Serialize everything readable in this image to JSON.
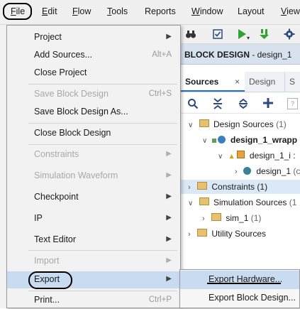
{
  "menubar": {
    "items": [
      {
        "label": "File",
        "mnemonic": "F",
        "rest": "ile"
      },
      {
        "label": "Edit",
        "mnemonic": "E",
        "rest": "dit"
      },
      {
        "label": "Flow",
        "mnemonic": "F",
        "rest": "low"
      },
      {
        "label": "Tools",
        "mnemonic": "T",
        "rest": "ools"
      },
      {
        "label": "Reports",
        "mnemonic": "",
        "rest": "Reports"
      },
      {
        "label": "Window",
        "mnemonic": "W",
        "rest": "indow"
      },
      {
        "label": "Layout",
        "mnemonic": "",
        "rest": "Layout"
      },
      {
        "label": "View",
        "mnemonic": "V",
        "rest": "iew"
      }
    ]
  },
  "file_menu": {
    "items": [
      {
        "label": "Project",
        "shortcut": "",
        "submenu": true,
        "disabled": false
      },
      {
        "label": "Add Sources...",
        "shortcut": "Alt+A",
        "submenu": false,
        "disabled": false
      },
      {
        "label": "Close Project",
        "shortcut": "",
        "submenu": false,
        "disabled": false
      },
      {
        "label": "Save Block Design",
        "shortcut": "Ctrl+S",
        "submenu": false,
        "disabled": true
      },
      {
        "label": "Save Block Design As...",
        "shortcut": "",
        "submenu": false,
        "disabled": false
      },
      {
        "label": "Close Block Design",
        "shortcut": "",
        "submenu": false,
        "disabled": false
      },
      {
        "label": "Constraints",
        "shortcut": "",
        "submenu": true,
        "disabled": true
      },
      {
        "label": "Simulation Waveform",
        "shortcut": "",
        "submenu": true,
        "disabled": true
      },
      {
        "label": "Checkpoint",
        "shortcut": "",
        "submenu": true,
        "disabled": false
      },
      {
        "label": "IP",
        "shortcut": "",
        "submenu": true,
        "disabled": false
      },
      {
        "label": "Text Editor",
        "shortcut": "",
        "submenu": true,
        "disabled": false
      },
      {
        "label": "Import",
        "shortcut": "",
        "submenu": true,
        "disabled": true
      },
      {
        "label": "Export",
        "shortcut": "",
        "submenu": true,
        "disabled": false
      },
      {
        "label": "Print...",
        "shortcut": "Ctrl+P",
        "submenu": false,
        "disabled": false
      }
    ]
  },
  "export_submenu": {
    "items": [
      {
        "label": "Export Hardware..."
      },
      {
        "label": "Export Block Design..."
      }
    ]
  },
  "block_design": {
    "title": "BLOCK DESIGN",
    "name": " - design_1"
  },
  "tabs": [
    {
      "label": "Sources"
    },
    {
      "label": "Design"
    },
    {
      "label": "S"
    }
  ],
  "tree": {
    "design_sources": {
      "label": "Design Sources",
      "count": "(1)"
    },
    "wrapper": {
      "label": "design_1_wrapp"
    },
    "design_1_i": {
      "label": "design_1_i :"
    },
    "design_1": {
      "label": "design_1",
      "suffix": "(c"
    },
    "constraints": {
      "label": "Constraints",
      "count": "(1)"
    },
    "simulation_sources": {
      "label": "Simulation Sources",
      "count": "(1"
    },
    "sim_1": {
      "label": "sim_1",
      "count": "(1)"
    },
    "utility_sources": {
      "label": "Utility Sources"
    }
  },
  "colors": {
    "accent": "#1f6fd1",
    "hover": "#c9dbf0",
    "disabled": "#a8a8a8",
    "folder": "#e8c170",
    "run_green": "#2fa52f"
  }
}
